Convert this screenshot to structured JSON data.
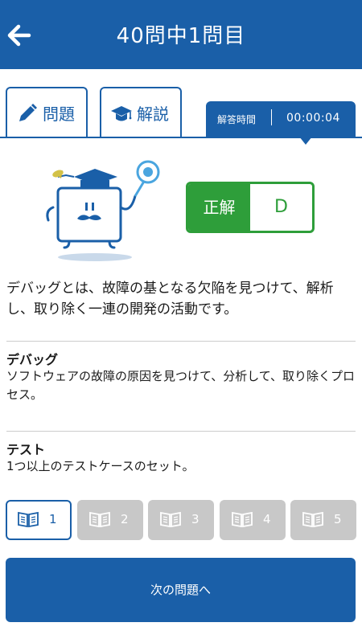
{
  "header": {
    "title": "40問中1問目",
    "back_icon": "arrow-left-icon"
  },
  "tabs": [
    {
      "label": "問題",
      "icon": "pencil-icon"
    },
    {
      "label": "解説",
      "icon": "graduation-cap-icon"
    }
  ],
  "timer": {
    "label": "解答時間",
    "separator": "|",
    "value": "00:00:04"
  },
  "result": {
    "status": "正解",
    "answer": "D"
  },
  "explanation": "デバッグとは、故障の基となる欠陥を見つけて、解析し、取り除く一連の開発の活動です。",
  "terms": [
    {
      "title": "デバッグ",
      "body": "ソフトウェアの故障の原因を見つけて、分析して、取り除くプロセス。"
    },
    {
      "title": "テスト",
      "body": "1つ以上のテストケースのセット。"
    }
  ],
  "pages": [
    "1",
    "2",
    "3",
    "4",
    "5"
  ],
  "next_button": "次の問題へ",
  "colors": {
    "primary": "#1a5fa8",
    "correct": "#2e9e3a",
    "disabled": "#c8c8c8"
  }
}
